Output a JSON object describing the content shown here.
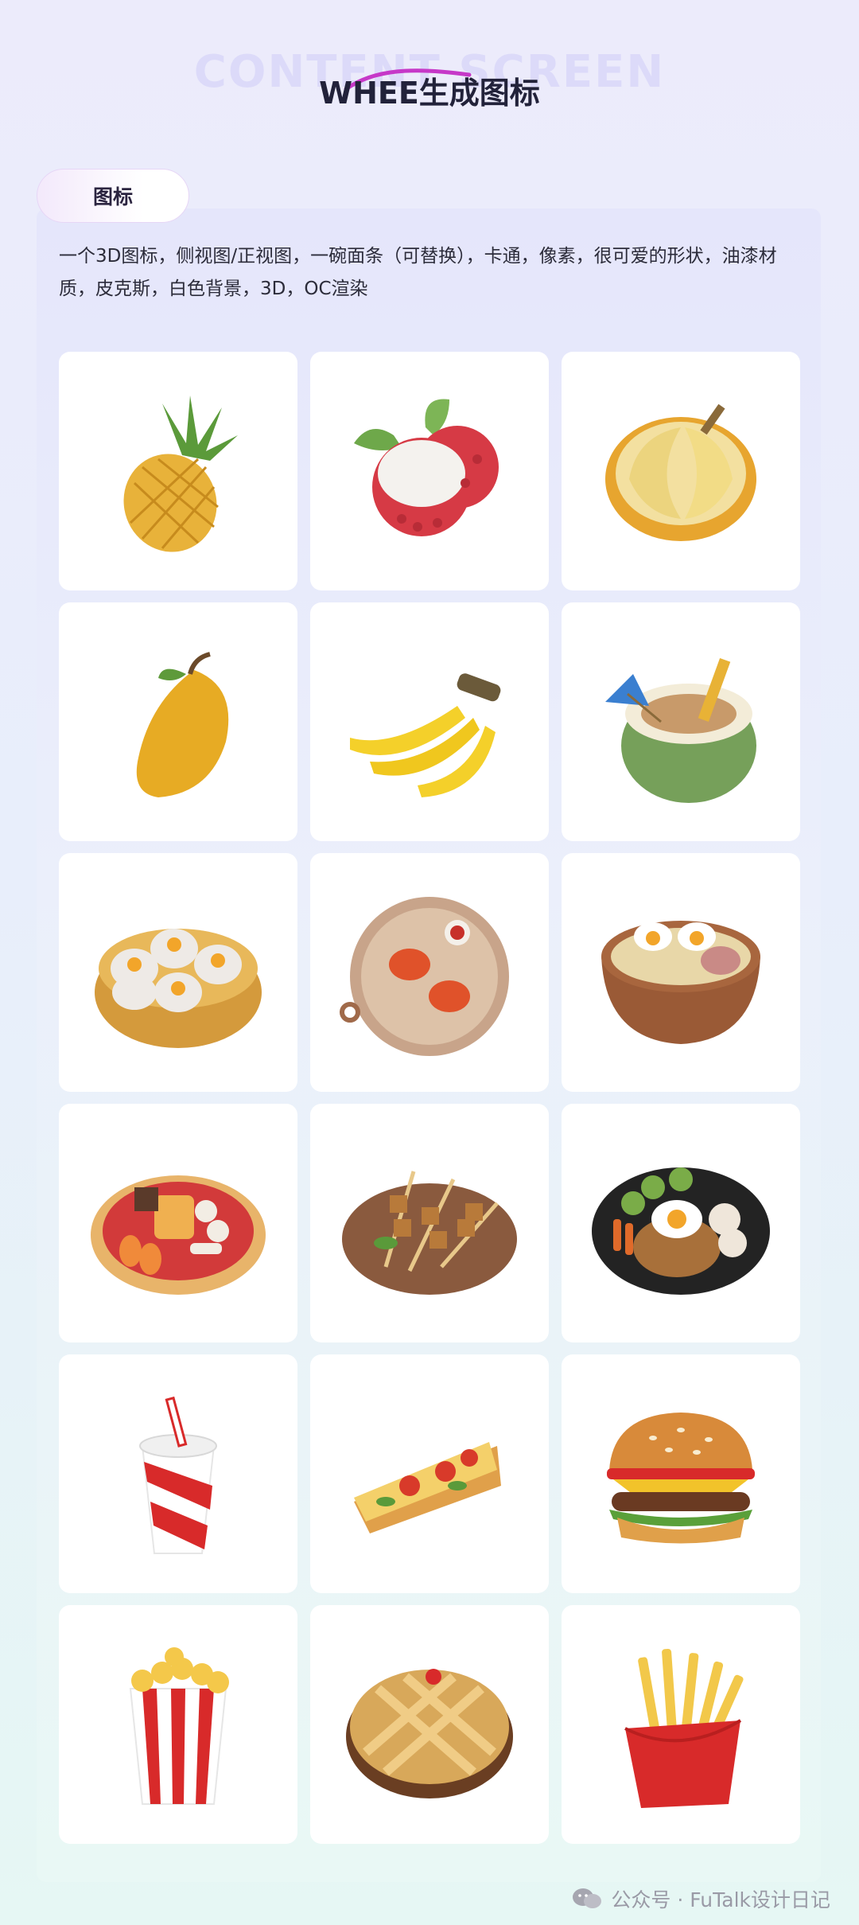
{
  "header": {
    "bg_title": "CONTENT SCREEN",
    "title": "WHEE生成图标"
  },
  "section": {
    "tab_label": "图标",
    "prompt": "一个3D图标，侧视图/正视图，一碗面条（可替换），卡通，像素，很可爱的形状，油漆材质，皮克斯，白色背景，3D，OC渲染"
  },
  "gallery": [
    "pineapple-icon",
    "lychee-icon",
    "durian-icon",
    "mango-icon",
    "banana-icon",
    "coconut-drink-icon",
    "dumpling-steamer-icon",
    "crab-platter-icon",
    "noodle-bowl-icon",
    "snack-platter-icon",
    "skewers-plate-icon",
    "fried-rice-plate-icon",
    "soda-cup-icon",
    "pizza-slice-icon",
    "burger-icon",
    "popcorn-icon",
    "pie-icon",
    "fries-icon"
  ],
  "watermark": {
    "text": "公众号 · FuTalk设计日记"
  }
}
